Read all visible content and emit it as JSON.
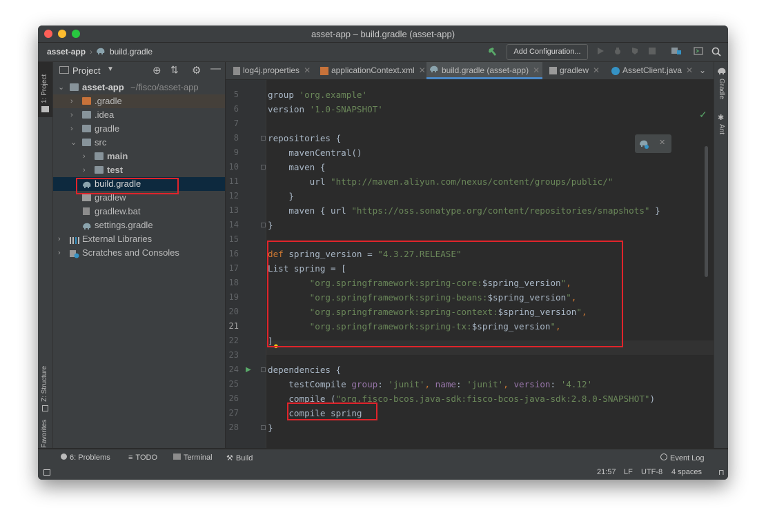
{
  "window": {
    "title": "asset-app – build.gradle (asset-app)"
  },
  "nav": {
    "project": "asset-app",
    "file": "build.gradle",
    "add_config": "Add Configuration..."
  },
  "left_tools": {
    "project": "1: Project",
    "structure": "Z: Structure",
    "favorites": "2: Favorites"
  },
  "right_tools": {
    "gradle": "Gradle",
    "ant": "Ant"
  },
  "project_panel": {
    "title": "Project",
    "tree": [
      {
        "label": "asset-app",
        "path": "~/fisco/asset-app"
      },
      {
        "label": ".gradle"
      },
      {
        "label": ".idea"
      },
      {
        "label": "gradle"
      },
      {
        "label": "src"
      },
      {
        "label": "main"
      },
      {
        "label": "test"
      },
      {
        "label": "build.gradle"
      },
      {
        "label": "gradlew"
      },
      {
        "label": "gradlew.bat"
      },
      {
        "label": "settings.gradle"
      },
      {
        "label": "External Libraries"
      },
      {
        "label": "Scratches and Consoles"
      }
    ]
  },
  "tabs": [
    {
      "label": "log4j.properties"
    },
    {
      "label": "applicationContext.xml"
    },
    {
      "label": "build.gradle (asset-app)"
    },
    {
      "label": "gradlew"
    },
    {
      "label": "AssetClient.java"
    }
  ],
  "editor": {
    "line_numbers": [
      "5",
      "6",
      "7",
      "8",
      "9",
      "10",
      "11",
      "12",
      "13",
      "14",
      "15",
      "16",
      "17",
      "18",
      "19",
      "20",
      "21",
      "22",
      "23",
      "24",
      "25",
      "26",
      "27",
      "28"
    ],
    "lines": [
      [
        {
          "t": "group ",
          "c": "p"
        },
        {
          "t": "'org.example'",
          "c": "s"
        }
      ],
      [
        {
          "t": "version ",
          "c": "p"
        },
        {
          "t": "'1.0-SNAPSHOT'",
          "c": "s"
        }
      ],
      [],
      [
        {
          "t": "repositories {",
          "c": "p"
        }
      ],
      [
        {
          "t": "    mavenCentral()",
          "c": "p"
        }
      ],
      [
        {
          "t": "    maven {",
          "c": "p"
        }
      ],
      [
        {
          "t": "        url ",
          "c": "p"
        },
        {
          "t": "\"http://maven.aliyun.com/nexus/content/groups/public/\"",
          "c": "s"
        }
      ],
      [
        {
          "t": "    }",
          "c": "p"
        }
      ],
      [
        {
          "t": "    maven { url ",
          "c": "p"
        },
        {
          "t": "\"https://oss.sonatype.org/content/repositories/snapshots\"",
          "c": "s"
        },
        {
          "t": " }",
          "c": "p"
        }
      ],
      [
        {
          "t": "}",
          "c": "p"
        }
      ],
      [],
      [
        {
          "t": "def",
          "c": "k"
        },
        {
          "t": " spring_version = ",
          "c": "p"
        },
        {
          "t": "\"4.3.27.RELEASE\"",
          "c": "s"
        }
      ],
      [
        {
          "t": "List spring = [",
          "c": "p"
        }
      ],
      [
        {
          "t": "        ",
          "c": "p"
        },
        {
          "t": "\"org.springframework:spring-core:",
          "c": "s"
        },
        {
          "t": "$spring_version",
          "c": "p"
        },
        {
          "t": "\"",
          "c": "s"
        },
        {
          "t": ",",
          "c": "k"
        }
      ],
      [
        {
          "t": "        ",
          "c": "p"
        },
        {
          "t": "\"org.springframework:spring-beans:",
          "c": "s"
        },
        {
          "t": "$spring_version",
          "c": "p"
        },
        {
          "t": "\"",
          "c": "s"
        },
        {
          "t": ",",
          "c": "k"
        }
      ],
      [
        {
          "t": "        ",
          "c": "p"
        },
        {
          "t": "\"org.springframework:spring-context:",
          "c": "s"
        },
        {
          "t": "$spring_version",
          "c": "p"
        },
        {
          "t": "\"",
          "c": "s"
        },
        {
          "t": ",",
          "c": "k"
        }
      ],
      [
        {
          "t": "        ",
          "c": "p"
        },
        {
          "t": "\"org.springframework:spring-tx:",
          "c": "s"
        },
        {
          "t": "$spring_version",
          "c": "p"
        },
        {
          "t": "\"",
          "c": "s"
        },
        {
          "t": ",",
          "c": "k"
        }
      ],
      [
        {
          "t": "]",
          "c": "p"
        }
      ],
      [],
      [
        {
          "t": "dependencies {",
          "c": "p"
        }
      ],
      [
        {
          "t": "    testCompile ",
          "c": "p"
        },
        {
          "t": "group",
          "c": "g"
        },
        {
          "t": ": ",
          "c": "p"
        },
        {
          "t": "'junit'",
          "c": "s"
        },
        {
          "t": ", ",
          "c": "k"
        },
        {
          "t": "name",
          "c": "g"
        },
        {
          "t": ": ",
          "c": "p"
        },
        {
          "t": "'junit'",
          "c": "s"
        },
        {
          "t": ", ",
          "c": "k"
        },
        {
          "t": "version",
          "c": "g"
        },
        {
          "t": ": ",
          "c": "p"
        },
        {
          "t": "'4.12'",
          "c": "s"
        }
      ],
      [
        {
          "t": "    compile (",
          "c": "p"
        },
        {
          "t": "\"org.fisco-bcos.java-sdk:fisco-bcos-java-sdk:2.8.0-SNAPSHOT\"",
          "c": "s"
        },
        {
          "t": ")",
          "c": "p"
        }
      ],
      [
        {
          "t": "    compile spring",
          "c": "p"
        }
      ],
      [
        {
          "t": "}",
          "c": "p"
        }
      ]
    ]
  },
  "status": {
    "problems": "6: Problems",
    "todo": "TODO",
    "terminal": "Terminal",
    "build": "Build",
    "event_log": "Event Log",
    "position": "21:57",
    "line_sep": "LF",
    "encoding": "UTF-8",
    "indent": "4 spaces"
  },
  "colors": {
    "keyword": "#cc7832",
    "string": "#6a8759",
    "plain": "#a9b7c6",
    "named_arg": "#9876aa",
    "highlight_box": "#e0242b",
    "selection": "#0d293e"
  }
}
